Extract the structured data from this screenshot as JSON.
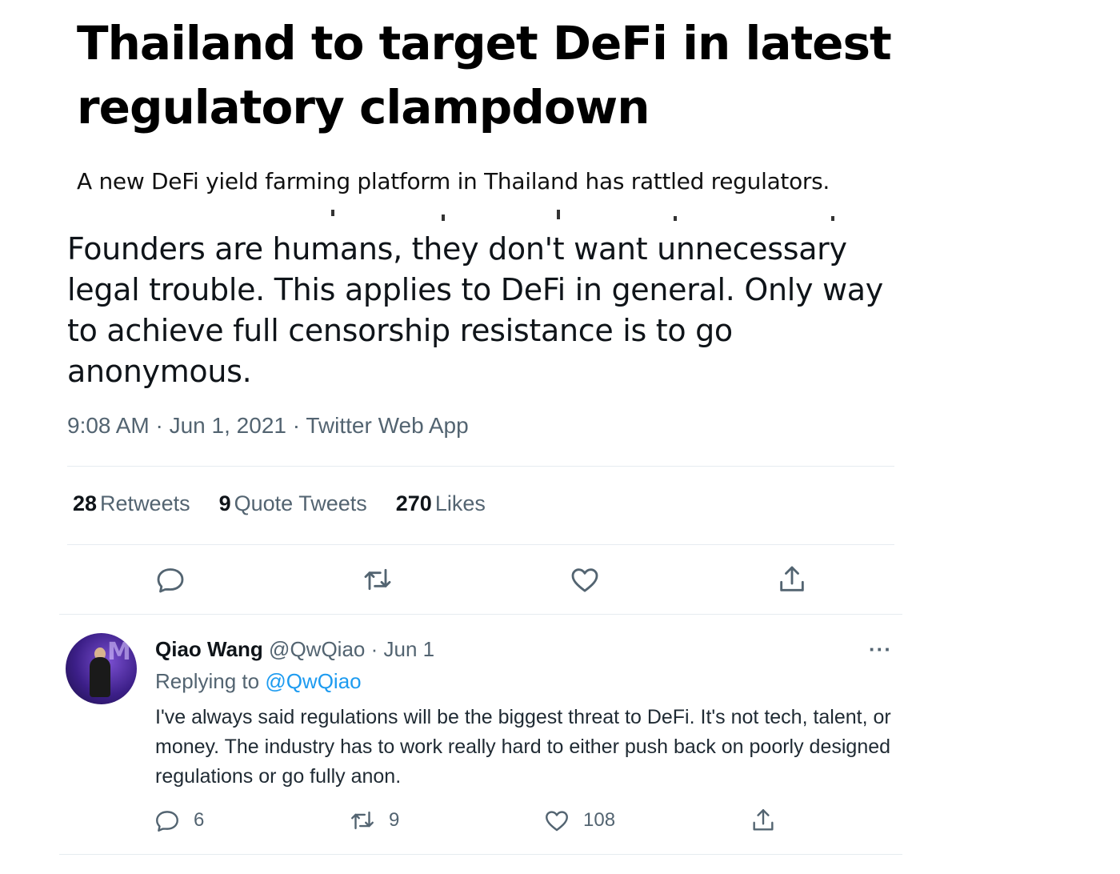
{
  "article": {
    "headline": "Thailand to target DeFi in latest regulatory clampdown",
    "subheadline": "A new DeFi yield farming platform in Thailand has rattled regulators."
  },
  "tweet": {
    "text": "Founders are humans, they don't want unnecessary legal trouble. This applies to DeFi in general. Only way to achieve full censorship resistance is to go anonymous.",
    "meta": "9:08 AM · Jun 1, 2021 · Twitter Web App",
    "stats": {
      "retweets_count": "28",
      "retweets_label": "Retweets",
      "quotes_count": "9",
      "quotes_label": "Quote Tweets",
      "likes_count": "270",
      "likes_label": "Likes"
    },
    "actions": [
      "reply-icon",
      "retweet-icon",
      "like-icon",
      "share-icon"
    ]
  },
  "reply": {
    "name": "Qiao Wang",
    "handle": "@QwQiao",
    "separator": " · ",
    "date": "Jun 1",
    "more": "···",
    "replying_prefix": "Replying to ",
    "replying_handle": "@QwQiao",
    "text": "I've always said regulations will be the biggest threat to DeFi. It's not tech, talent, or money. The industry has to work really hard to either push back on poorly designed regulations or go fully anon.",
    "reply_count": "6",
    "retweet_count": "9",
    "like_count": "108"
  },
  "colors": {
    "text": "#0f1419",
    "secondary": "#536471",
    "link": "#1d9bf0",
    "divider": "#e6ecf0"
  }
}
